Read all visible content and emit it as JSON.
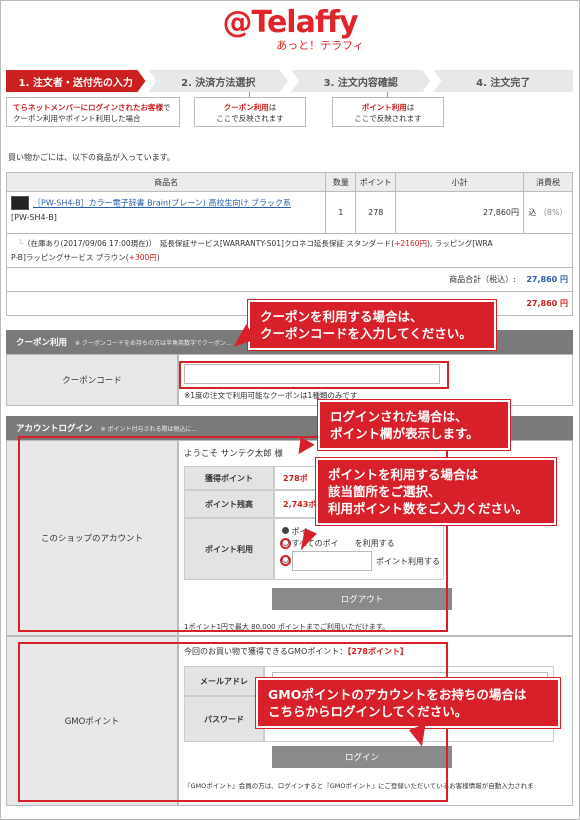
{
  "brand": {
    "logo": "@Telaffy",
    "sub": "あっと！テラフィ"
  },
  "steps": [
    "1. 注文者・送付先の入力",
    "2. 決済方法選択",
    "3. 注文内容確認",
    "4. 注文完了"
  ],
  "notes": {
    "n1_red": "てらネットメンバーにログインされたお客様",
    "n1_tail": "で",
    "n1_line2": "クーポン利用やポイント利用した場合",
    "n2_red": "クーポン利用",
    "n2_tail": "は",
    "n2_line2": "ここで反映されます",
    "n3_red": "ポイント利用",
    "n3_tail": "は",
    "n3_line2": "ここで反映されます"
  },
  "cart_intro": "買い物かごには、以下の商品が入っています。",
  "cart": {
    "headers": [
      "商品名",
      "数量",
      "ポイント",
      "小計",
      "消費税"
    ],
    "item_name": "［PW-SH4-B］カラー電子辞書 Brain(ブレーン) 高校生向け ブラック系",
    "item_code": "[PW-SH4-B]",
    "qty": "1",
    "points": "278",
    "subtotal": "27,860円",
    "tax_prefix": "込",
    "tax": "（8%）",
    "option_pre": "（在庫あり(2017/09/06 17:00現在)）　延長保証サービス[WARRANTY-S01]クロネコ延長保証 スタンダード(",
    "option_red1": "+2160円",
    "option_mid": "), ラッピング[WRA",
    "option_line2_pre": "P-B]ラッピングサービス ブラウン(",
    "option_red2": "+300円",
    "option_line2_post": ")",
    "total_label": "商品合計（税込）:",
    "total_value": "27,860 円",
    "grand_total": "27,860 円"
  },
  "coupon": {
    "header": "クーポン利用",
    "header_note": "※ クーポンコードをお持ちの方は半角英数字でクーポン...",
    "label": "クーポンコード",
    "input_value": "",
    "note": "※1度の注文で利用可能なクーポンは1種類のみです"
  },
  "account": {
    "header": "アカウントログイン",
    "header_note": "※ ポイント付与される際は税込に...",
    "shop_label": "このショップのアカウント",
    "welcome": "ようこそ サンテク太郎 様",
    "earn_label": "獲得ポイント",
    "earn_value": "278ポ",
    "balance_label": "ポイント残高",
    "balance_value": "2,743ポ",
    "use_label": "ポイント利用",
    "radio1": "ポイ",
    "radio2": "すべてのポイ　　を利用する",
    "radio3": "ポイント利用する",
    "logout": "ログアウト",
    "point_note": "1ポイント1円で最大 80,000 ポイントまでご利用いただけます。",
    "gmo_label": "GMOポイント",
    "gmo_text_pre": "今回のお買い物で獲得できるGMOポイント：",
    "gmo_text_red": "【278ポイント】",
    "mail_label": "メールアドレ",
    "pass_label": "パスワード",
    "login": "ログイン",
    "gmo_note": "『GMOポイント』会員の方は、ログインすると『GMOポイント』にご登録いただいているお客様情報が自動入力されま"
  },
  "callouts": {
    "c1": "クーポンを利用する場合は、\nクーポンコードを入力してください。",
    "c2": "ログインされた場合は、\nポイント欄が表示します。",
    "c3": "ポイントを利用する場合は\n該当箇所をご選択、\n利用ポイント数をご入力ください。",
    "c4": "GMOポイントのアカウントをお持ちの場合は\nこちらからログインしてください。"
  }
}
